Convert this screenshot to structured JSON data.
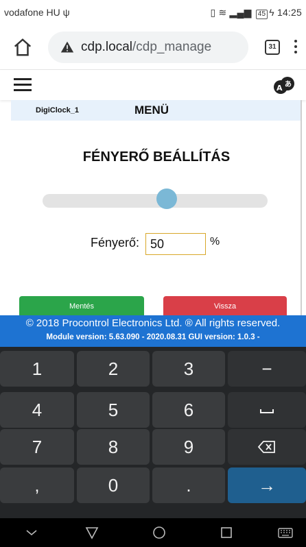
{
  "status_bar": {
    "carrier": "vodafone HU",
    "battery": "45",
    "time": "14:25"
  },
  "browser": {
    "url_host": "cdp.local",
    "url_path": "/cdp_manage",
    "tabs_count": "31"
  },
  "panel": {
    "device_name": "DigiClock_1",
    "menu_title": "MENÜ",
    "page_title": "FÉNYERŐ BEÁLLÍTÁS",
    "brightness_label": "Fényerő:",
    "brightness_value": "50",
    "unit": "%",
    "slider_percent": 50,
    "save_label": "Mentés",
    "back_label": "Vissza",
    "colors": {
      "save": "#2ba54a",
      "back": "#d93f48",
      "slider": "#7bb8d6"
    }
  },
  "footer": {
    "copyright": "© 2018 Procontrol Electronics Ltd. ® All rights reserved.",
    "versions": "Module version: 5.63.090 - 2020.08.31    GUI version: 1.0.3 -",
    "color": "#1e73d2"
  },
  "keyboard": {
    "keys": [
      {
        "label": "1",
        "name": "key-1"
      },
      {
        "label": "2",
        "name": "key-2"
      },
      {
        "label": "3",
        "name": "key-3"
      },
      {
        "label": "−",
        "name": "key-minus"
      },
      {
        "label": "4",
        "name": "key-4"
      },
      {
        "label": "5",
        "name": "key-5"
      },
      {
        "label": "6",
        "name": "key-6"
      },
      {
        "label": "",
        "name": "key-space",
        "icon": "space-icon"
      },
      {
        "label": "7",
        "name": "key-7"
      },
      {
        "label": "8",
        "name": "key-8"
      },
      {
        "label": "9",
        "name": "key-9"
      },
      {
        "label": "",
        "name": "key-backspace",
        "icon": "backspace-icon"
      },
      {
        "label": ",",
        "name": "key-comma"
      },
      {
        "label": "0",
        "name": "key-0"
      },
      {
        "label": ".",
        "name": "key-period"
      },
      {
        "label": "→",
        "name": "key-enter"
      }
    ]
  },
  "icons": {
    "home": "home-icon",
    "warning": "warning-icon",
    "menu": "hamburger-icon",
    "language": "translate-icon",
    "nav": [
      "chevron-down-icon",
      "back-triangle-icon",
      "home-circle-icon",
      "recents-square-icon",
      "keyboard-icon"
    ]
  }
}
